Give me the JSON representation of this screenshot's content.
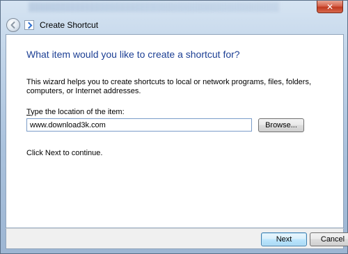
{
  "window": {
    "title": "Create Shortcut",
    "close_glyph": "✕"
  },
  "header": {
    "back_icon": "back-arrow-icon",
    "wizard_icon": "shortcut-wizard-icon"
  },
  "content": {
    "heading": "What item would you like to create a shortcut for?",
    "description": "This wizard helps you to create shortcuts to local or network programs, files, folders, computers, or Internet addresses.",
    "location_label_prefix": "T",
    "location_label_rest": "ype the location of the item:",
    "location_value": "www.download3k.com",
    "browse_label": "Browse...",
    "hint": "Click Next to continue."
  },
  "footer": {
    "next_label": "Next",
    "cancel_label": "Cancel"
  },
  "colors": {
    "heading": "#1c3f94",
    "client_bg": "#ffffff",
    "footer_bg": "#f0f0f0"
  }
}
